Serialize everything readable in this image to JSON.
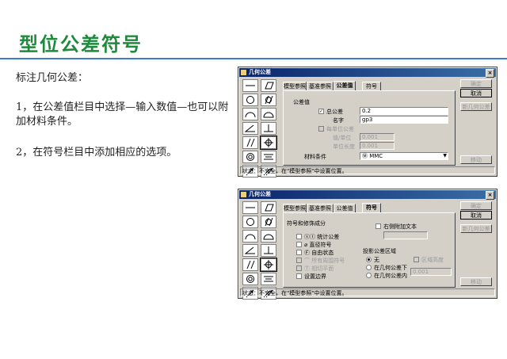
{
  "slide": {
    "title": "型位公差符号",
    "bullets": [
      "标注几何公差：",
      "1，在公差值栏目中选择—输入数值—也可以附加材料条件。",
      "2，在符号栏目中添加相应的选项。"
    ],
    "accent_color": "#1e8a3c",
    "rule_color": "#3b7fc1"
  },
  "dialog1": {
    "title": "几何公差",
    "tabs": [
      "模型参照",
      "基准参照",
      "公差值",
      "符号"
    ],
    "active_tab": "公差值",
    "buttons": {
      "ok": "确定",
      "cancel": "取消",
      "new": "新几何公差",
      "move": "移动"
    },
    "group_label": "公差值",
    "total_tol_label": "总公差",
    "total_tol_value": "0.2",
    "name_label": "名字",
    "name_value": "gp3",
    "per_unit_label": "每单位公差",
    "value_unit_label": "值/单位",
    "value_unit_value": "0.001",
    "unit_length_label": "单位长度",
    "unit_length_value": "0.001",
    "material_label": "材料条件",
    "material_value": "Ⓜ MMC",
    "status": "状态：不完全，在\"模型参照\"中设置位置。"
  },
  "dialog2": {
    "title": "几何公差",
    "tabs": [
      "模型参照",
      "基准参照",
      "公差值",
      "符号"
    ],
    "active_tab": "符号",
    "buttons": {
      "ok": "确定",
      "cancel": "取消",
      "new": "新几何公差",
      "move": "移动"
    },
    "group_label": "符号和修饰成分",
    "options": [
      {
        "label": "统计公差",
        "glyph": "ⓢⓣ"
      },
      {
        "label": "直径符号",
        "glyph": "⌀"
      },
      {
        "label": "自由状态",
        "glyph": "Ⓕ"
      },
      {
        "label": "所有周围符号",
        "glyph": "⌒"
      },
      {
        "label": "相切平面",
        "glyph": "Ⓣ"
      },
      {
        "label": "设置边界",
        "glyph": ""
      }
    ],
    "extra_text_label": "右侧附加文本",
    "proj_label": "投影公差区域",
    "proj_none": "无",
    "proj_below": "在几何公差下",
    "proj_inside": "在几何公差内",
    "zone_height_label": "区域高度",
    "zone_height_value": "0.001",
    "status": "状态：不完全，在\"模型参照\"中设置位置。"
  },
  "symbols": [
    "straightness",
    "flatness",
    "circularity",
    "cylindricity",
    "line-profile",
    "surface-profile",
    "angularity",
    "perpendicularity",
    "parallelism",
    "position",
    "concentricity",
    "symmetry",
    "circular-runout",
    "total-runout"
  ]
}
